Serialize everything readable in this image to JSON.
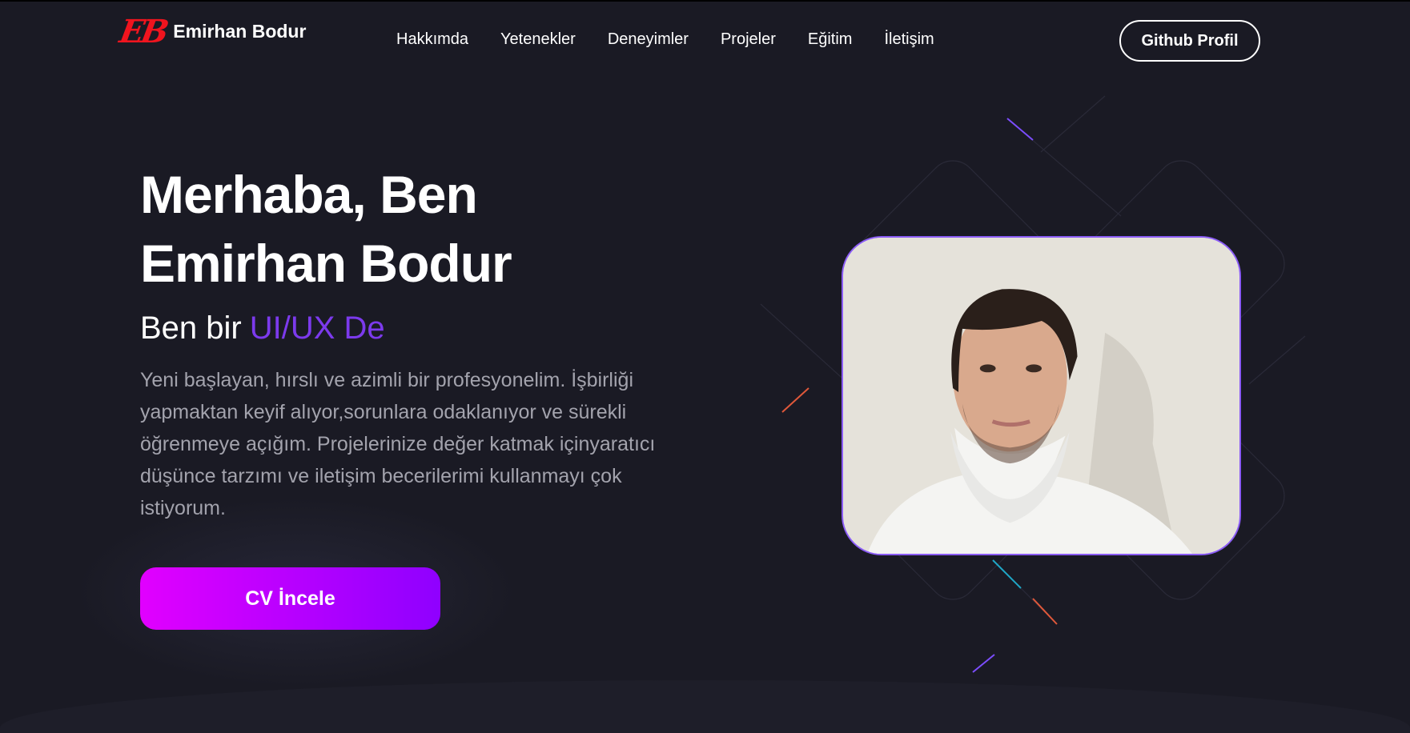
{
  "header": {
    "logo_mark": "EB",
    "name": "Emirhan Bodur",
    "nav": [
      "Hakkımda",
      "Yetenekler",
      "Deneyimler",
      "Projeler",
      "Eğitim",
      "İletişim"
    ],
    "github_label": "Github Profil"
  },
  "hero": {
    "title_line1": "Merhaba, Ben",
    "title_line2": "Emirhan Bodur",
    "role_prefix": "Ben bir",
    "role_typed": "UI/UX De",
    "description": "Yeni başlayan, hırslı ve azimli bir profesyonelim. İşbirliği yapmaktan keyif alıyor,sorunlara odaklanıyor ve sürekli öğrenmeye açığım. Projelerinize değer katmak içinyaratıcı düşünce tarzımı ve iletişim becerilerimi kullanmayı çok istiyorum.",
    "cv_label": "CV İncele"
  },
  "colors": {
    "background": "#1a1a24",
    "accent": "#7c3aed",
    "logo": "#f0141e",
    "button_start": "#e100ff",
    "button_end": "#8f00ff"
  }
}
